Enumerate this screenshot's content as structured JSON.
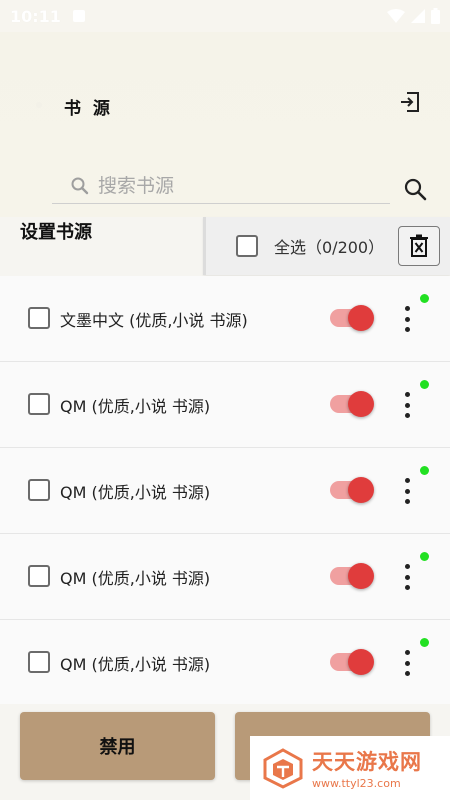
{
  "status_bar": {
    "time": "10:11"
  },
  "header": {
    "title": "书 源",
    "search_placeholder": "搜索书源"
  },
  "section_label": "设置书源",
  "select_all": {
    "label": "全选（0/200）"
  },
  "sources": [
    {
      "name": "文墨中文 (优质,小说 书源)",
      "enabled": true,
      "online": true
    },
    {
      "name": "QM (优质,小说 书源)",
      "enabled": true,
      "online": true
    },
    {
      "name": "QM (优质,小说 书源)",
      "enabled": true,
      "online": true
    },
    {
      "name": "QM (优质,小说 书源)",
      "enabled": true,
      "online": true
    },
    {
      "name": "QM (优质,小说 书源)",
      "enabled": true,
      "online": true
    }
  ],
  "bottom": {
    "disable_label": "禁用",
    "enable_label": ""
  },
  "watermark": {
    "name": "天天游戏网",
    "url": "www.ttyl23.com"
  },
  "colors": {
    "accent_button": "#b89a78",
    "switch_on": "#e03c3c",
    "online_dot": "#22e022",
    "watermark": "#e9774a"
  },
  "icons": {
    "import": "import-icon",
    "search": "search-icon",
    "delete": "delete-icon",
    "more": "more-vertical-icon"
  }
}
